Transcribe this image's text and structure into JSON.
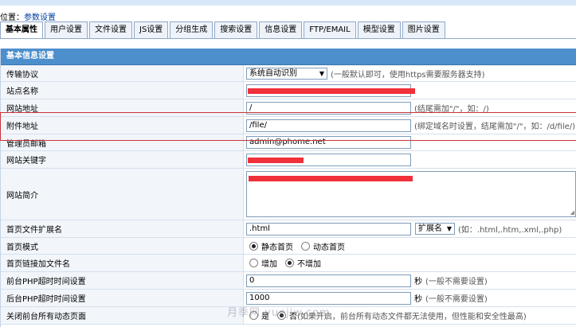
{
  "breadcrumb": {
    "prefix": "位置：",
    "link": "参数设置"
  },
  "tabs": [
    "基本属性",
    "用户设置",
    "文件设置",
    "JS设置",
    "分组生成",
    "搜索设置",
    "信息设置",
    "FTP/EMAIL",
    "模型设置",
    "图片设置"
  ],
  "panel_title": "基本信息设置",
  "fields": {
    "protocol": {
      "label": "传输协议",
      "value": "系统自动识别",
      "hint": "(一般默认即可，使用https需要服务器支持)"
    },
    "site_name": {
      "label": "站点名称"
    },
    "site_url": {
      "label": "网站地址",
      "value": "/",
      "hint": "(结尾需加\"/\"，如：/)"
    },
    "attach_url": {
      "label": "附件地址",
      "value": "/file/",
      "hint": "(绑定域名时设置，结尾需加\"/\"，如：/d/file/)"
    },
    "admin_email": {
      "label": "管理员邮箱",
      "value": "admin@phome.net"
    },
    "keywords": {
      "label": "网站关键字"
    },
    "intro": {
      "label": "网站简介"
    },
    "index_ext": {
      "label": "首页文件扩展名",
      "value": ".html",
      "select": "扩展名",
      "hint": "(如：.html,.htm,.xml,.php)"
    },
    "index_mode": {
      "label": "首页模式",
      "opt1": "静态首页",
      "opt2": "动态首页"
    },
    "index_link": {
      "label": "首页链接加文件名",
      "opt1": "增加",
      "opt2": "不增加"
    },
    "front_timeout": {
      "label": "前台PHP超时时间设置",
      "value": "0",
      "unit": "秒",
      "hint": "(一般不需要设置)"
    },
    "back_timeout": {
      "label": "后台PHP超时时间设置",
      "value": "1000",
      "unit": "秒",
      "hint": "(一般不需要设置)"
    },
    "close_dynamic": {
      "label": "关闭前台所有动态页面",
      "opt1": "是",
      "opt2": "否",
      "hint": "(如果开启，前台所有动态文件都无法使用，但性能和安全性最高)"
    }
  },
  "watermark": "月季网 yuejiw.com",
  "colors": {
    "header": "#4d8fcc",
    "label_bg": "#f2f6fb",
    "redaction": "#f0303a",
    "link": "#0040a0"
  }
}
